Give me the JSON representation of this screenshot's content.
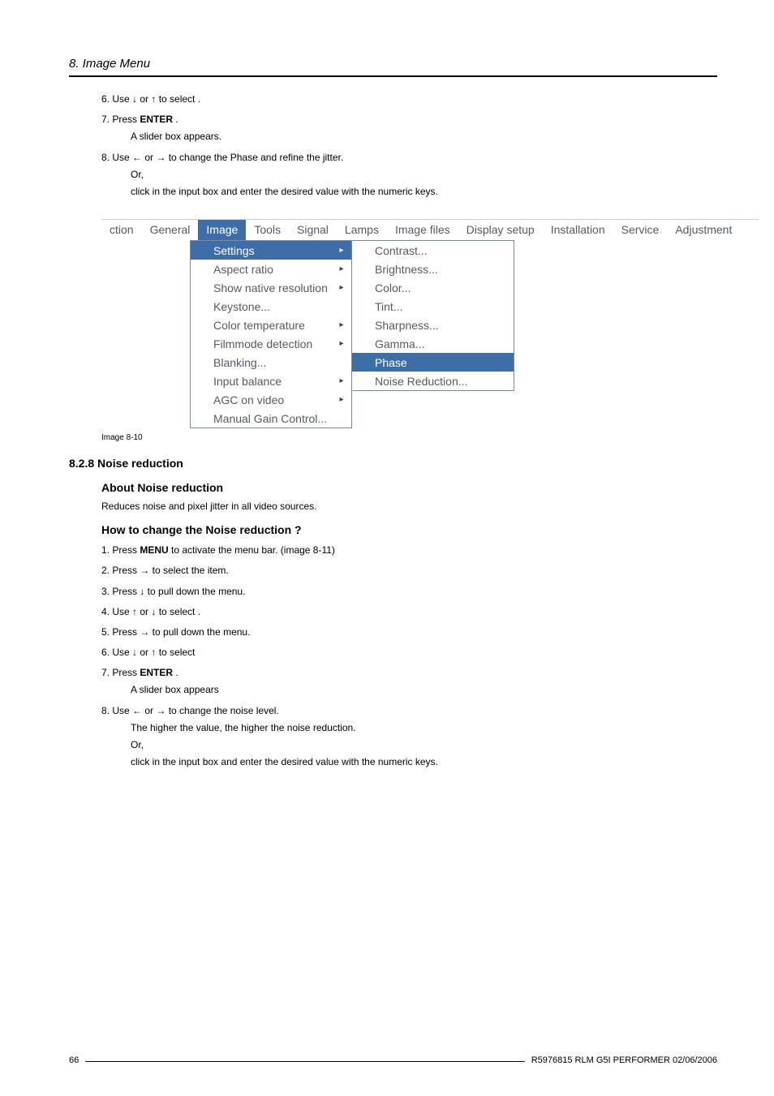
{
  "header": {
    "title": "8. Image Menu"
  },
  "stepsA": [
    {
      "pre": "6.  Use ↓ or ↑ to select ",
      "post": "."
    },
    {
      "pre": "7.  Press ",
      "bold": "ENTER",
      "post": " .",
      "note": "A slider box appears."
    },
    {
      "pre": "8.  Use ← or → to change the Phase and refine the jitter.",
      "note_or": "Or,",
      "note2": "click in the input box and enter the desired value with the numeric keys."
    }
  ],
  "menu": {
    "bar": [
      "ction",
      "General",
      "Image",
      "Tools",
      "Signal",
      "Lamps",
      "Image files",
      "Display setup",
      "Installation",
      "Service",
      "Adjustment"
    ],
    "active_bar": "Image",
    "dd1": [
      {
        "label": "Settings",
        "arrow": true,
        "selected": true
      },
      {
        "label": "Aspect ratio",
        "arrow": true
      },
      {
        "label": "Show native resolution",
        "arrow": true
      },
      {
        "label": "Keystone..."
      },
      {
        "label": "Color temperature",
        "arrow": true
      },
      {
        "label": "Filmmode detection",
        "arrow": true
      },
      {
        "label": "Blanking..."
      },
      {
        "label": "Input balance",
        "arrow": true
      },
      {
        "label": "AGC on video",
        "arrow": true
      },
      {
        "label": "Manual Gain Control..."
      }
    ],
    "dd2": [
      {
        "label": "Contrast..."
      },
      {
        "label": "Brightness..."
      },
      {
        "label": "Color..."
      },
      {
        "label": "Tint..."
      },
      {
        "label": "Sharpness..."
      },
      {
        "label": "Gamma..."
      },
      {
        "label": "Phase",
        "selected": true
      },
      {
        "label": "Noise Reduction..."
      }
    ]
  },
  "caption1": "Image 8-10",
  "h828": "8.2.8    Noise reduction",
  "about_h": "About Noise reduction",
  "about_p": "Reduces noise and pixel jitter in all video sources.",
  "howto_h": "How to change the Noise reduction ?",
  "stepsB": [
    {
      "text_a": "1.  Press ",
      "bold": "MENU",
      "text_b": " to activate the menu bar.  (image 8-11)"
    },
    {
      "text_a": "2.  Press → to select the ",
      "text_b": "item."
    },
    {
      "text_a": "3.  Press ↓ to pull down the ",
      "text_b": "menu."
    },
    {
      "text_a": "4.  Use ↑ or ↓ to select ",
      "text_b": "."
    },
    {
      "text_a": "5.  Press → to pull down the menu."
    },
    {
      "text_a": "6.  Use ↓ or ↑ to select "
    },
    {
      "text_a": "7.  Press ",
      "bold": "ENTER",
      "text_b": " .",
      "note": "A slider box appears"
    },
    {
      "text_a": "8.  Use ← or → to change the noise level.",
      "note": "The higher the value, the higher the noise reduction.",
      "note_or": "Or,",
      "note2": "click in the input box and enter the desired value with the numeric keys."
    }
  ],
  "footer": {
    "page": "66",
    "right": "R5976815  RLM G5I PERFORMER  02/06/2006"
  }
}
